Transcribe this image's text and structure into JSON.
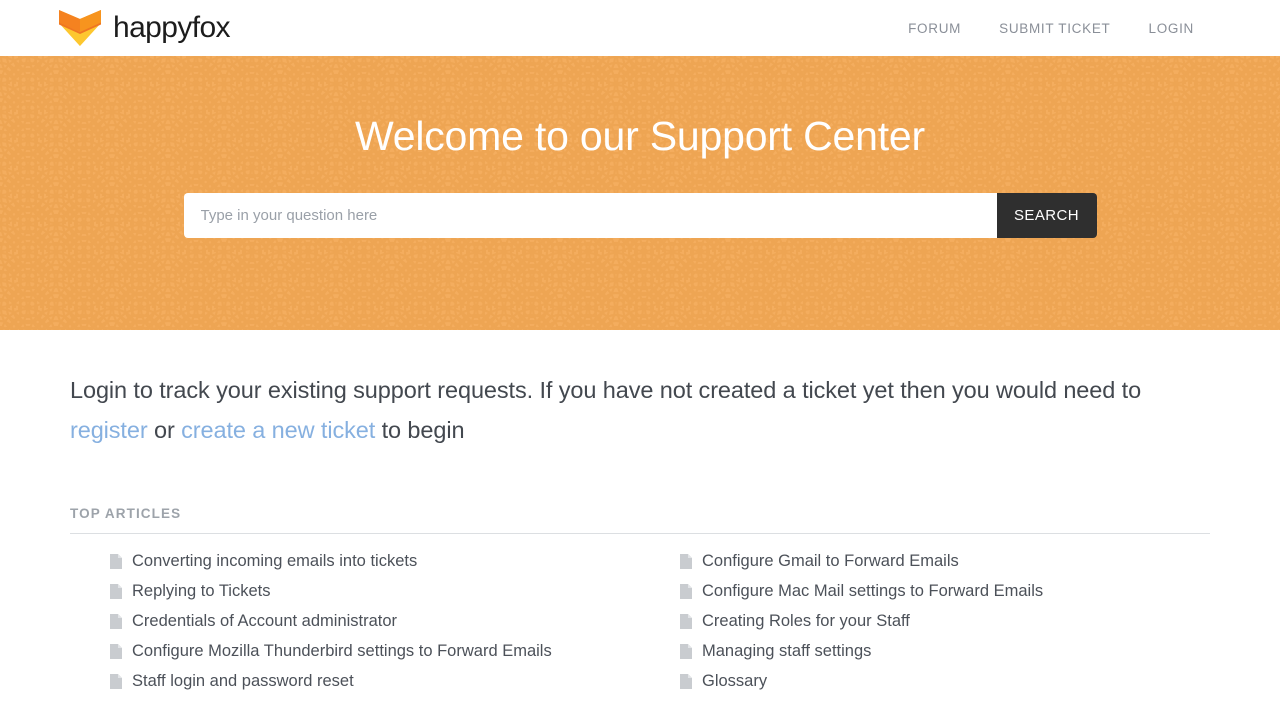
{
  "header": {
    "brand_name": "happyfox",
    "logo_icon": "happyfox-fox-logo",
    "logo_colors": {
      "top": "#f58220",
      "bottom": "#fdc72f",
      "mid": "#ef7622"
    },
    "nav": [
      {
        "label": "FORUM",
        "name": "nav-forum"
      },
      {
        "label": "SUBMIT TICKET",
        "name": "nav-submit-ticket"
      },
      {
        "label": "LOGIN",
        "name": "nav-login"
      }
    ]
  },
  "hero": {
    "title": "Welcome to our Support Center",
    "background_color": "#f4ad5e",
    "pattern": "seigaiha-wave-arcs",
    "search": {
      "placeholder": "Type in your question here",
      "value": "",
      "button_label": "SEARCH",
      "button_color": "#2f2f2f"
    }
  },
  "main": {
    "intro": {
      "part1": "Login to track your existing support requests. If you have not created a ticket yet then you would need to ",
      "link_register": "register",
      "part2": " or ",
      "link_new_ticket": "create a new ticket",
      "part3": " to begin",
      "link_color": "#86b0e0"
    },
    "top_articles": {
      "heading": "TOP ARTICLES",
      "icon": "document-icon",
      "left_column": [
        "Converting incoming emails into tickets",
        "Replying to Tickets",
        "Credentials of Account administrator",
        "Configure Mozilla Thunderbird settings to Forward Emails",
        "Staff login and password reset"
      ],
      "right_column": [
        "Configure Gmail to Forward Emails",
        "Configure Mac Mail settings to Forward Emails",
        "Creating Roles for your Staff",
        "Managing staff settings",
        "Glossary"
      ]
    }
  }
}
